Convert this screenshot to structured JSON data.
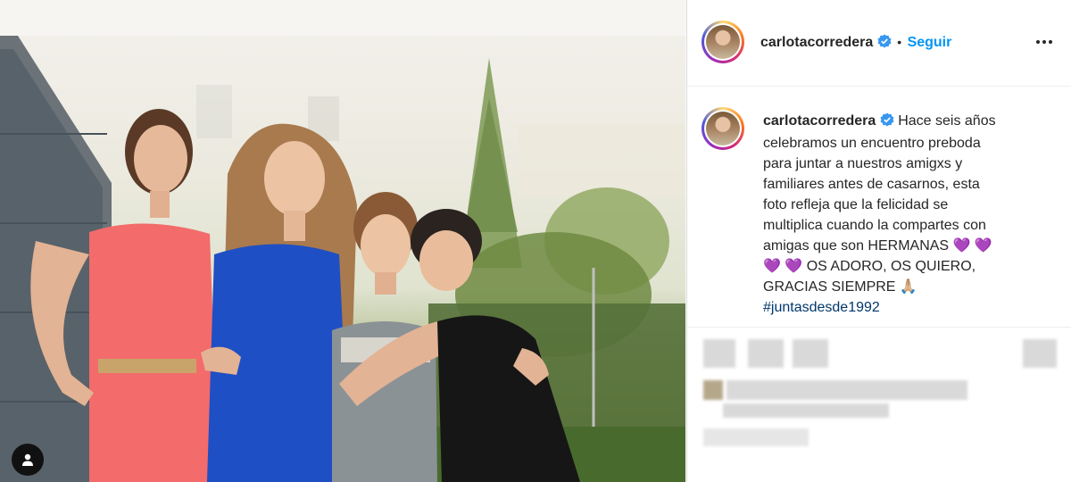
{
  "post": {
    "author": {
      "username": "carlotacorredera",
      "verified": true,
      "follow_label": "Seguir",
      "separator": "•"
    },
    "caption": {
      "lines": [
        "Hace seis años",
        "celebramos un encuentro preboda",
        "para juntar a nuestros amigxs y",
        "familiares antes de casarnos, esta",
        "foto refleja que la felicidad se",
        "multiplica cuando la compartes con",
        "amigas que son HERMANAS 💜 💜",
        "💜 💜  OS ADORO, OS QUIERO,",
        "GRACIAS SIEMPRE 🙏🏼"
      ],
      "hashtag": "#juntasdesde1992"
    },
    "icons": {
      "more": "more-options-icon",
      "verified": "verified-badge-icon",
      "tagged_users": "user-tag-icon"
    },
    "colors": {
      "link_blue": "#0095f6",
      "verified_blue": "#3897f0",
      "hashtag": "#00376b"
    }
  }
}
